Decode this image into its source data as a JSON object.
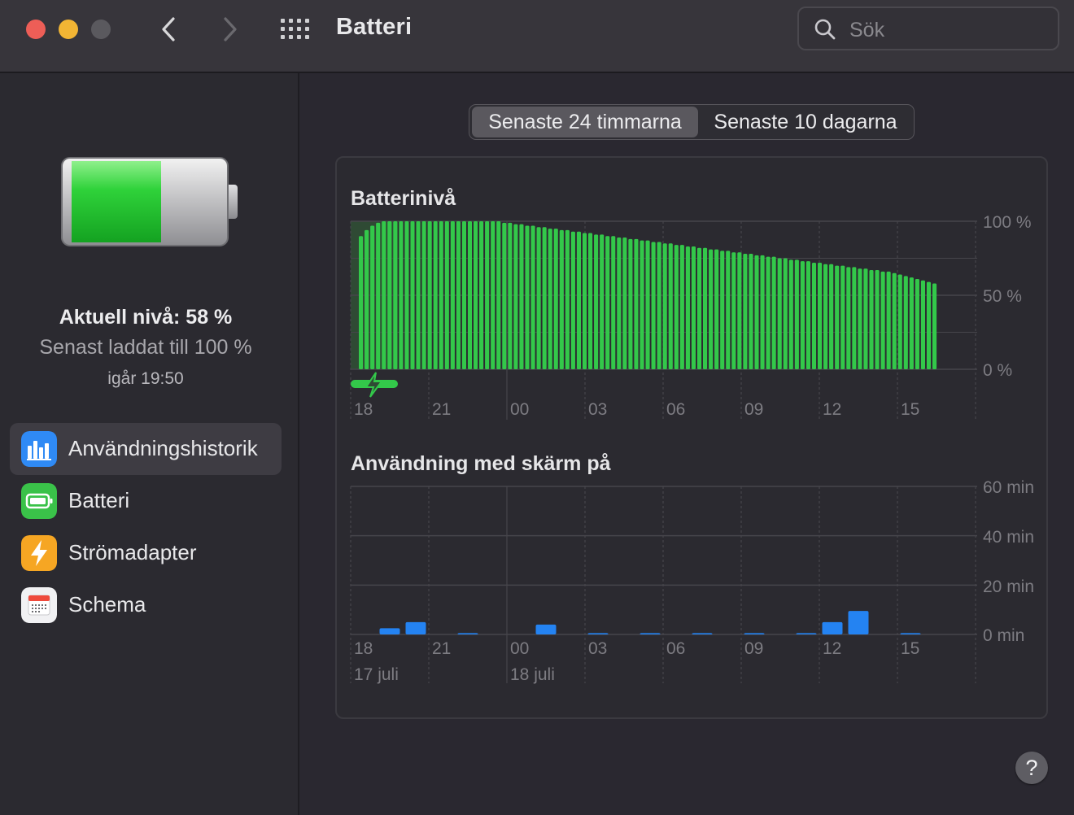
{
  "window": {
    "title": "Batteri",
    "search_placeholder": "Sök"
  },
  "sidebar": {
    "current_level": "Aktuell nivå: 58 %",
    "last_charged": "Senast laddat till 100 %",
    "last_charged_time": "igår 19:50",
    "battery_level_fraction": 0.58,
    "items": [
      {
        "label": "Användningshistorik",
        "icon": "bar-chart-icon",
        "icon_color": "#2f8af5",
        "active": true
      },
      {
        "label": "Batteri",
        "icon": "battery-icon",
        "icon_color": "#3ac249",
        "active": false
      },
      {
        "label": "Strömadapter",
        "icon": "bolt-icon",
        "icon_color": "#f6a623",
        "active": false
      },
      {
        "label": "Schema",
        "icon": "calendar-icon",
        "icon_color": "#f1f1f3",
        "active": false
      }
    ]
  },
  "tabs": [
    {
      "label": "Senaste 24 timmarna",
      "selected": true
    },
    {
      "label": "Senaste 10 dagarna",
      "selected": false
    }
  ],
  "colors": {
    "battery_green": "#33c84a",
    "usage_blue": "#2483f2",
    "charging_highlight": "#2f4a34"
  },
  "chart_data": [
    {
      "type": "bar",
      "title": "Batterinivå",
      "x_tick_labels": [
        "18",
        "21",
        "00",
        "03",
        "06",
        "09",
        "12",
        "15"
      ],
      "y_tick_labels": [
        "100 %",
        "50 %",
        "0 %"
      ],
      "ylim": [
        0,
        100
      ],
      "grid": true,
      "charging_period": "18–19:50",
      "series": [
        {
          "values": [
            90,
            94,
            97,
            99,
            100,
            100,
            100,
            100,
            100,
            100,
            100,
            100,
            100,
            100,
            100,
            100,
            100,
            100,
            100,
            100,
            100,
            100,
            100,
            100,
            100,
            99,
            99,
            98,
            98,
            97,
            97,
            96,
            96,
            95,
            95,
            94,
            94,
            93,
            93,
            92,
            92,
            91,
            91,
            90,
            90,
            89,
            89,
            88,
            88,
            87,
            87,
            86,
            86,
            85,
            85,
            84,
            84,
            83,
            83,
            82,
            82,
            81,
            81,
            80,
            80,
            79,
            79,
            78,
            78,
            77,
            77,
            76,
            76,
            75,
            75,
            74,
            74,
            73,
            73,
            72,
            72,
            71,
            71,
            70,
            70,
            69,
            69,
            68,
            68,
            67,
            67,
            66,
            66,
            65,
            64,
            63,
            62,
            61,
            60,
            59,
            58
          ]
        }
      ]
    },
    {
      "type": "bar",
      "title": "Användning med skärm på",
      "x_tick_labels": [
        "18",
        "21",
        "00",
        "03",
        "06",
        "09",
        "12",
        "15"
      ],
      "x_date_labels": [
        "17 juli",
        "18 juli"
      ],
      "y_tick_labels": [
        "60 min",
        "40 min",
        "20 min",
        "0 min"
      ],
      "ylim": [
        0,
        60
      ],
      "grid": true,
      "categories": [
        "18",
        "19",
        "20",
        "21",
        "22",
        "23",
        "00",
        "01",
        "02",
        "03",
        "04",
        "05",
        "06",
        "07",
        "08",
        "09",
        "10",
        "11",
        "12",
        "13",
        "14",
        "15",
        "16",
        "17"
      ],
      "series": [
        {
          "values": [
            0,
            2.5,
            5,
            0,
            0.5,
            0,
            0,
            4,
            0,
            0.5,
            0,
            0.5,
            0,
            0.5,
            0,
            0.5,
            0,
            0.5,
            5,
            9.5,
            0,
            0.5,
            0,
            0
          ]
        }
      ]
    }
  ]
}
